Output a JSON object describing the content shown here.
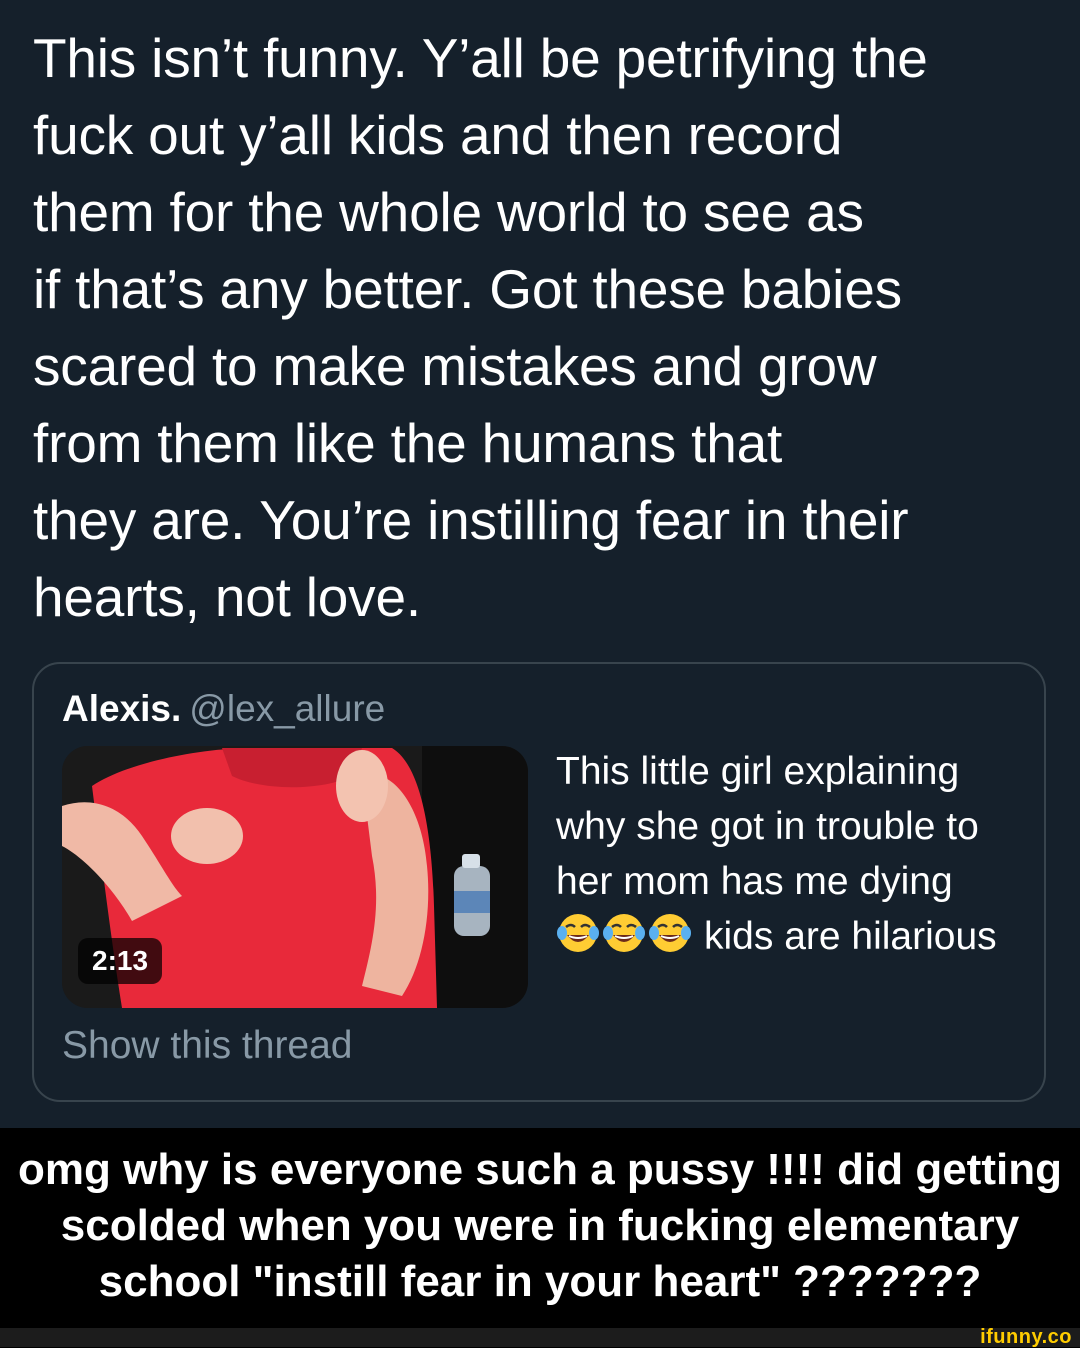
{
  "tweet": {
    "text": "This isn’t funny. Y’all be petrifying the\nfuck out y’all kids and then record\nthem for the whole world to see as\nif that’s any better. Got these babies\nscared to make mistakes and grow\nfrom them like the humans that\nthey are. You’re instilling fear in their\nhearts, not love."
  },
  "quote": {
    "name": "Alexis.",
    "handle": "@lex_allure",
    "video_duration": "2:13",
    "text_before_emoji": "This little girl explaining why she got in trouble to her mom has me dying",
    "emoji": [
      "face-with-tears-of-joy-icon",
      "face-with-tears-of-joy-icon",
      "face-with-tears-of-joy-icon"
    ],
    "text_after_emoji": "kids are hilarious",
    "show_thread": "Show this thread"
  },
  "caption": {
    "text": "omg why is everyone such a pussy !!!! did getting scolded when you were in fucking elementary school \"instill fear in your heart\" ???????"
  },
  "watermark": "ifunny.co",
  "colors": {
    "background": "#15202b",
    "border": "#38444d",
    "secondary_text": "#8899a6",
    "shirt_red": "#e8293a",
    "watermark_yellow": "#ffcc00"
  }
}
